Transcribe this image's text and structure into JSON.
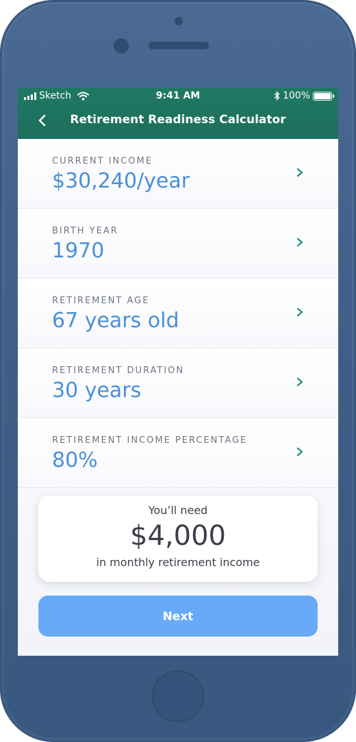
{
  "status_bar": {
    "carrier": "Sketch",
    "time": "9:41 AM",
    "battery": "100%"
  },
  "nav": {
    "title": "Retirement Readiness Calculator"
  },
  "fields": [
    {
      "label": "CURRENT INCOME",
      "value": "$30,240/year"
    },
    {
      "label": "BIRTH YEAR",
      "value": "1970"
    },
    {
      "label": "RETIREMENT AGE",
      "value": "67 years old"
    },
    {
      "label": "RETIREMENT DURATION",
      "value": "30 years"
    },
    {
      "label": "RETIREMENT INCOME PERCENTAGE",
      "value": "80%"
    }
  ],
  "summary": {
    "pre_text": "You’ll need",
    "amount": "$4,000",
    "post_text": "in monthly retirement income"
  },
  "next_button": {
    "label": "Next"
  },
  "colors": {
    "header": "#1f7863",
    "value_blue": "#4b8fd8",
    "chevron": "#24947a",
    "button": "#68aaf9",
    "phone_body": "#4a6a93"
  },
  "icons": [
    "cellular-signal-icon",
    "wifi-icon",
    "bluetooth-icon",
    "battery-icon",
    "back-chevron-icon",
    "chevron-right-icon"
  ]
}
